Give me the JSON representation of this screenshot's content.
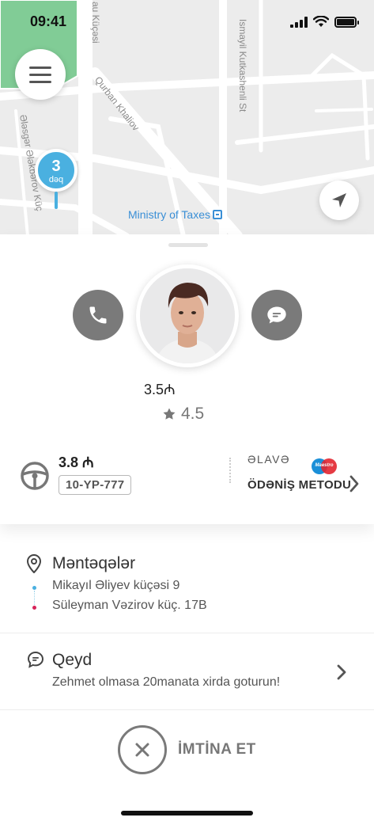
{
  "status_bar": {
    "time": "09:41"
  },
  "map": {
    "streets": [
      "au Küçəsi",
      "Qurban Khaliov",
      "Ismayil Kutkashenli St",
      "Ələsgər Ələkbərov Küç"
    ],
    "poi_label": "Ministry of Taxes",
    "eta": {
      "value": "3",
      "unit": "dəq"
    }
  },
  "driver": {
    "price": "3.5₼",
    "rating": "4.5"
  },
  "trip": {
    "price": "3.8 ₼",
    "plate": "10-YP-777",
    "payment_extra_label": "ƏLAVƏ",
    "payment_brand": "Maestro",
    "payment_method_label": "ÖDƏNİŞ METODU"
  },
  "stops": {
    "title": "Məntəqələr",
    "items": [
      {
        "label": "Mikayıl Əliyev küçəsi 9",
        "color": "#4ab0e0"
      },
      {
        "label": "Süleyman Vəzirov küç. 17B",
        "color": "#d6245a"
      }
    ]
  },
  "note": {
    "title": "Qeyd",
    "text": "Zehmet olmasa 20manata xirda goturun!"
  },
  "cancel": {
    "label": "İMTİNA ET"
  },
  "colors": {
    "accent": "#4ab0e0",
    "button_gray": "#7a7a7a"
  }
}
